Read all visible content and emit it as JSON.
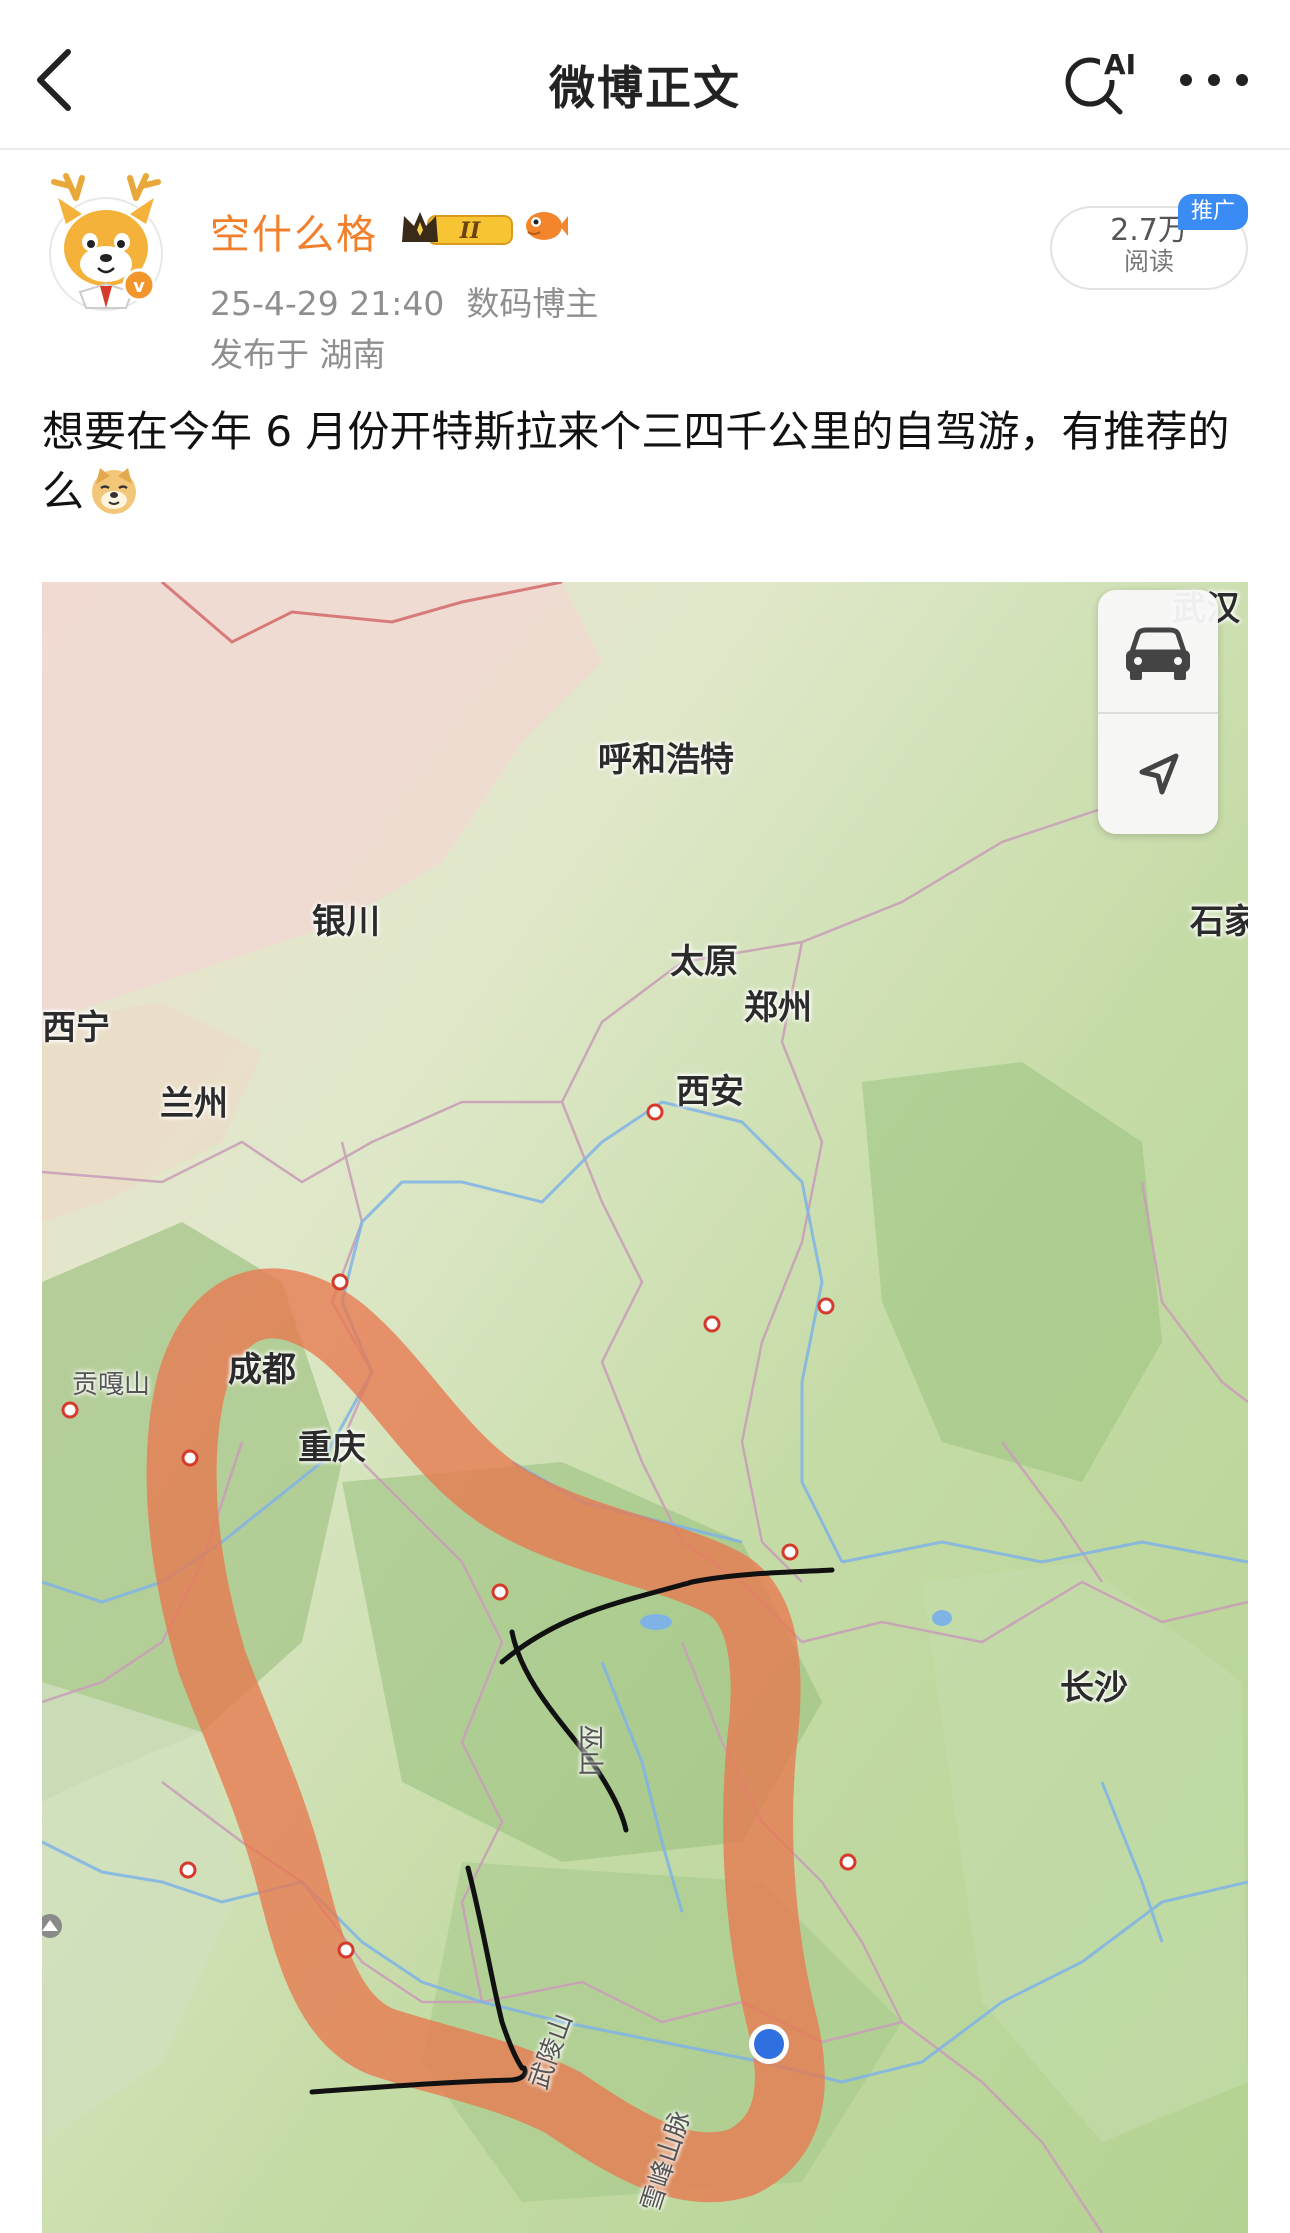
{
  "header": {
    "title": "微博正文",
    "back_icon": "chevron-left-icon",
    "ai_icon": "ai-search-icon",
    "ai_label": "AI",
    "more_icon": "more-horizontal-icon"
  },
  "author": {
    "name": "空什么格",
    "level_badge": "II",
    "verified": "v",
    "datetime": "25-4-29 21:40",
    "category": "数码博主",
    "location": "发布于 湖南"
  },
  "stats": {
    "reads": "2.7万",
    "reads_label": "阅读",
    "promo_tag": "推广"
  },
  "post": {
    "text": "想要在今年 6 月份开特斯拉来个三四千公里的自驾游，有推荐的么",
    "emoji": "doge-emoji"
  },
  "map": {
    "cities": [
      {
        "id": "huhehaote",
        "label": "呼和浩特"
      },
      {
        "id": "yinchuan",
        "label": "银川"
      },
      {
        "id": "taiyuan",
        "label": "太原"
      },
      {
        "id": "shijiazhuang",
        "label": "石家"
      },
      {
        "id": "xining",
        "label": "西宁"
      },
      {
        "id": "lanzhou",
        "label": "兰州"
      },
      {
        "id": "zhengzhou",
        "label": "郑州"
      },
      {
        "id": "xian",
        "label": "西安"
      },
      {
        "id": "wuhan",
        "label": "武汉"
      },
      {
        "id": "chengdu",
        "label": "成都"
      },
      {
        "id": "gonggashan",
        "label": "贡嘎山"
      },
      {
        "id": "chongqing",
        "label": "重庆"
      },
      {
        "id": "changsha",
        "label": "长沙"
      },
      {
        "id": "wulingshan",
        "label": "武陵山"
      },
      {
        "id": "wushan",
        "label": "巫山"
      },
      {
        "id": "xuefengshan",
        "label": "雪峰山脉"
      }
    ],
    "controls": {
      "car_icon": "car-icon",
      "locate_icon": "navigation-arrow-icon"
    },
    "route_color": "#e8794f"
  }
}
